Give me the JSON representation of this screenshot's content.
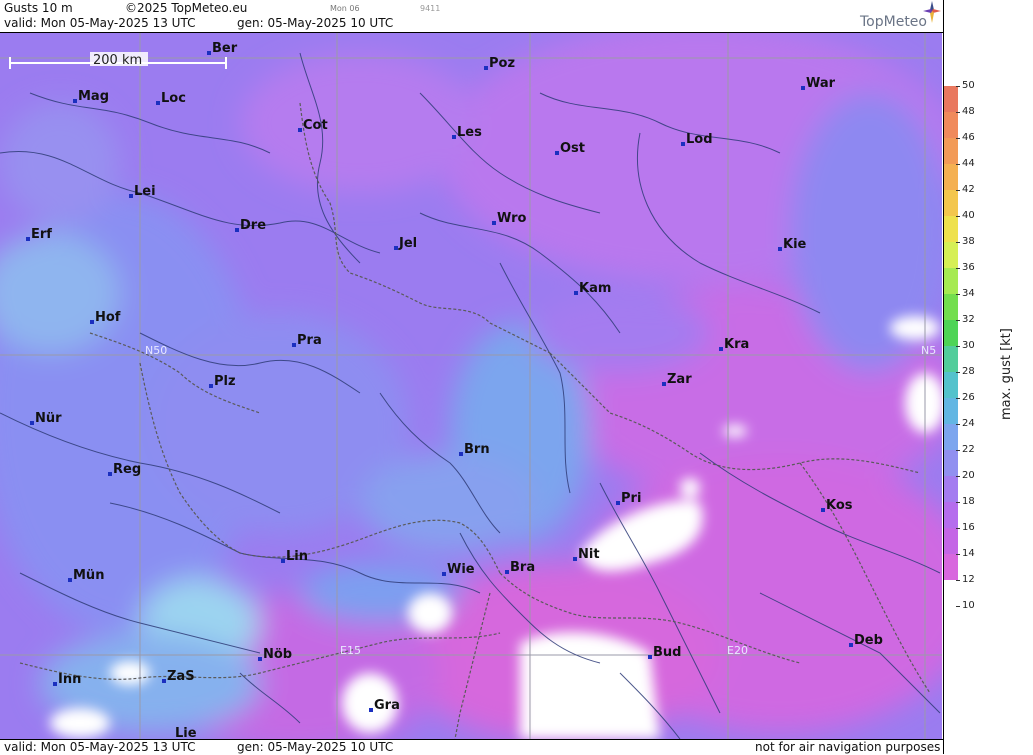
{
  "header": {
    "product": "Gusts 10 m",
    "copyright": "©2025 TopMeteo.eu",
    "small_day": "Mon 06",
    "small_code": "9411",
    "valid": "valid:  Mon  05-May-2025  13 UTC",
    "gen": "gen: 05-May-2025 10 UTC",
    "logo": "TopMeteo"
  },
  "footer": {
    "valid": "valid:  Mon  05-May-2025  13 UTC",
    "gen": "gen: 05-May-2025 10 UTC",
    "note": "not for air navigation purposes"
  },
  "map": {
    "scale_label": "200 km",
    "grid_labels": [
      "N50",
      "N5",
      "E15",
      "E20"
    ],
    "cities": [
      {
        "name": "Ber"
      },
      {
        "name": "Poz"
      },
      {
        "name": "War"
      },
      {
        "name": "Mag"
      },
      {
        "name": "Loc"
      },
      {
        "name": "Cot"
      },
      {
        "name": "Les"
      },
      {
        "name": "Ost"
      },
      {
        "name": "Lod"
      },
      {
        "name": "Lei"
      },
      {
        "name": "Dre"
      },
      {
        "name": "Wro"
      },
      {
        "name": "Erf"
      },
      {
        "name": "Jel"
      },
      {
        "name": "Kie"
      },
      {
        "name": "Kam"
      },
      {
        "name": "Hof"
      },
      {
        "name": "Pra"
      },
      {
        "name": "Kra"
      },
      {
        "name": "Zar"
      },
      {
        "name": "Plz"
      },
      {
        "name": "Nür"
      },
      {
        "name": "Brn"
      },
      {
        "name": "Reg"
      },
      {
        "name": "Pri"
      },
      {
        "name": "Kos"
      },
      {
        "name": "Lin"
      },
      {
        "name": "Nit"
      },
      {
        "name": "Wie"
      },
      {
        "name": "Bra"
      },
      {
        "name": "Mün"
      },
      {
        "name": "Deb"
      },
      {
        "name": "Nöb"
      },
      {
        "name": "Bud"
      },
      {
        "name": "Inn"
      },
      {
        "name": "ZaS"
      },
      {
        "name": "Gra"
      },
      {
        "name": "Lie"
      }
    ]
  },
  "legend": {
    "title": "max. gust [kt]",
    "ticks": [
      "50",
      "48",
      "46",
      "44",
      "42",
      "40",
      "38",
      "36",
      "34",
      "32",
      "30",
      "28",
      "26",
      "24",
      "22",
      "20",
      "18",
      "16",
      "14",
      "12",
      "10"
    ],
    "colors": [
      "#e9785f",
      "#f08a5c",
      "#f29a57",
      "#f4b052",
      "#f3c64d",
      "#eee14d",
      "#d6ef55",
      "#a6ea52",
      "#73de4e",
      "#4ed456",
      "#52cd9b",
      "#54c2cc",
      "#62b6e3",
      "#7ca5ee",
      "#9190f0",
      "#a47cf0",
      "#b56ded",
      "#c466e6",
      "#d867de",
      "#ffffff"
    ]
  }
}
